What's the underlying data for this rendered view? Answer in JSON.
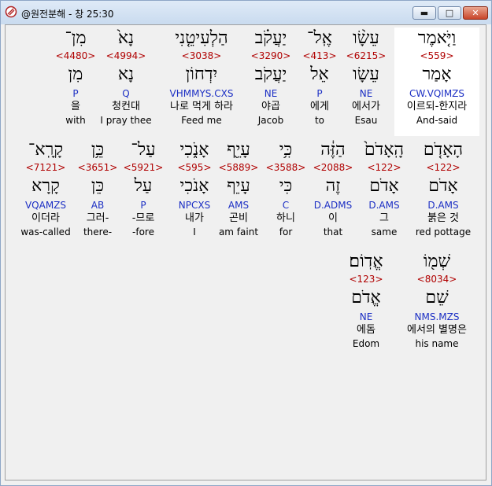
{
  "window": {
    "title": "@원전분해 - 창 25:30",
    "controls": {
      "minimize": "▬",
      "maximize": "□",
      "close": "✕"
    }
  },
  "rows": [
    [
      {
        "heb": "וַיֹּ֤אמֶר",
        "strong": "<559>",
        "lemma": "אָמַר",
        "morph": "CW.VQIMZS",
        "kor": "이르되-한지라",
        "eng": "And-said",
        "highlight": true
      },
      {
        "heb": "עֵשָׂ֨ו",
        "strong": "<6215>",
        "lemma": "עֵשָׂו",
        "morph": "NE",
        "kor": "에서가",
        "eng": "Esau"
      },
      {
        "heb": "אֶֽל־",
        "strong": "<413>",
        "lemma": "אֵל",
        "morph": "P",
        "kor": "에게",
        "eng": "to"
      },
      {
        "heb": "יַעֲקֹ֗ב",
        "strong": "<3290>",
        "lemma": "יַעֲקֹב",
        "morph": "NE",
        "kor": "야곱",
        "eng": "Jacob"
      },
      {
        "heb": "הַלְעִיטֵ֤נִי",
        "strong": "<3038>",
        "lemma": "יִדְחוֹן",
        "morph": "VHMMYS.CXS",
        "kor": "나로 먹게 하라",
        "eng": "Feed me"
      },
      {
        "heb": "נָא֙",
        "strong": "<4994>",
        "lemma": "נָא",
        "morph": "Q",
        "kor": "청컨대",
        "eng": "I pray thee"
      },
      {
        "heb": "מִן־",
        "strong": "<4480>",
        "lemma": "מִן",
        "morph": "P",
        "kor": "을",
        "eng": "with"
      }
    ],
    [
      {
        "heb": "הָאָדֹ֤ם",
        "strong": "<122>",
        "lemma": "אָדֹם",
        "morph": "D.AMS",
        "kor": "붉은 것",
        "eng": "red pottage"
      },
      {
        "heb": "הָֽאָדֹם֙",
        "strong": "<122>",
        "lemma": "אָדֹם",
        "morph": "D.AMS",
        "kor": "그",
        "eng": "same"
      },
      {
        "heb": "הַזֶּ֔ה",
        "strong": "<2088>",
        "lemma": "זֶה",
        "morph": "D.ADMS",
        "kor": "이",
        "eng": "that"
      },
      {
        "heb": "כִּ֥י",
        "strong": "<3588>",
        "lemma": "כִּי",
        "morph": "C",
        "kor": "하니",
        "eng": "for"
      },
      {
        "heb": "עָיֵ֖ף",
        "strong": "<5889>",
        "lemma": "עָיֵף",
        "morph": "AMS",
        "kor": "곤비",
        "eng": "am faint"
      },
      {
        "heb": "אָנֹ֑כִי",
        "strong": "<595>",
        "lemma": "אָנֹכִי",
        "morph": "NPCXS",
        "kor": "내가",
        "eng": "I"
      },
      {
        "heb": "עַל־",
        "strong": "<5921>",
        "lemma": "עַל",
        "morph": "P",
        "kor": "-므로",
        "eng": "-fore"
      },
      {
        "heb": "כֵּ֥ן",
        "strong": "<3651>",
        "lemma": "כֵּן",
        "morph": "AB",
        "kor": "그러-",
        "eng": "there-"
      },
      {
        "heb": "קָרָֽא־",
        "strong": "<7121>",
        "lemma": "קָרָא",
        "morph": "VQAMZS",
        "kor": "이더라",
        "eng": "was-called"
      }
    ],
    [
      {
        "heb": "שְׁמ֖וֹ",
        "strong": "<8034>",
        "lemma": "שֵׁם",
        "morph": "NMS.MZS",
        "kor": "에서의 별명은",
        "eng": "his name"
      },
      {
        "heb": "אֱדֽוֹם׃",
        "strong": "<123>",
        "lemma": "אֱדֹם",
        "morph": "NE",
        "kor": "에돔",
        "eng": "Edom"
      }
    ]
  ]
}
